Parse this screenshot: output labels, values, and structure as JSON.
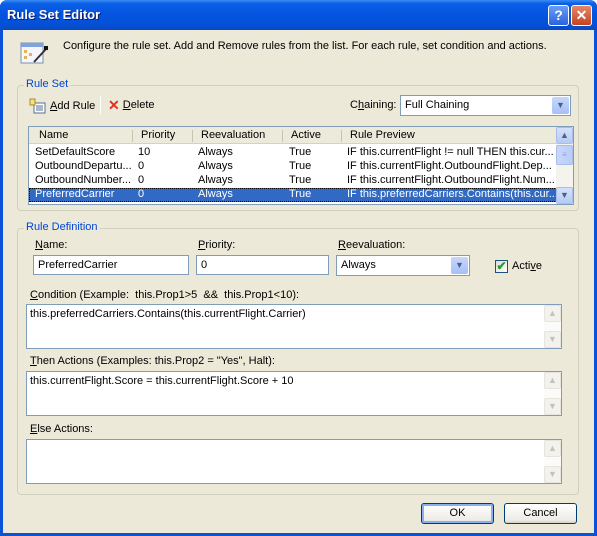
{
  "window": {
    "title": "Rule Set Editor",
    "help_glyph": "?",
    "close_glyph": "✕"
  },
  "header": {
    "icon": "rule-set-editor-icon",
    "description": "Configure the rule set. Add and Remove rules from the list. For each rule, set condition and actions."
  },
  "rule_set": {
    "group_label": "Rule Set",
    "toolbar": {
      "add_rule": {
        "icon": "add-rule-icon",
        "mnemonic": "A",
        "rest": "dd Rule"
      },
      "delete": {
        "icon": "delete-x-icon",
        "mnemonic": "D",
        "rest": "elete"
      }
    },
    "chaining": {
      "label_pre": "C",
      "label_mnemonic": "h",
      "label_post": "aining:",
      "value": "Full Chaining"
    },
    "columns": [
      "Name",
      "Priority",
      "Reevaluation",
      "Active",
      "Rule Preview"
    ],
    "rows": [
      {
        "name": "SetDefaultScore",
        "priority": "10",
        "reevaluation": "Always",
        "active": "True",
        "preview": "IF this.currentFlight != null THEN this.cur..."
      },
      {
        "name": "OutboundDepartu...",
        "priority": "0",
        "reevaluation": "Always",
        "active": "True",
        "preview": "IF this.currentFlight.OutboundFlight.Dep..."
      },
      {
        "name": "OutboundNumber...",
        "priority": "0",
        "reevaluation": "Always",
        "active": "True",
        "preview": "IF this.currentFlight.OutboundFlight.Num..."
      },
      {
        "name": "PreferredCarrier",
        "priority": "0",
        "reevaluation": "Always",
        "active": "True",
        "preview": "IF this.preferredCarriers.Contains(this.cur..."
      }
    ],
    "selected_row": 3
  },
  "rule_definition": {
    "group_label": "Rule Definition",
    "name": {
      "mnemonic": "N",
      "rest": "ame:",
      "value": "PreferredCarrier"
    },
    "priority": {
      "mnemonic": "P",
      "rest": "riority:",
      "value": "0"
    },
    "reevaluation": {
      "mnemonic": "R",
      "rest": "eevaluation:",
      "value": "Always"
    },
    "active": {
      "pre": "Acti",
      "mnemonic": "v",
      "post": "e",
      "checked": true
    },
    "condition": {
      "mnemonic": "C",
      "rest": "ondition (Example:  this.Prop1>5  &&  this.Prop1<10):",
      "value": "this.preferredCarriers.Contains(this.currentFlight.Carrier)"
    },
    "then_actions": {
      "mnemonic": "T",
      "rest": "hen Actions (Examples: this.Prop2 = \"Yes\", Halt):",
      "value": "this.currentFlight.Score = this.currentFlight.Score + 10"
    },
    "else_actions": {
      "mnemonic": "E",
      "rest": "lse Actions:",
      "value": ""
    }
  },
  "buttons": {
    "ok": "OK",
    "cancel": "Cancel"
  },
  "glyphs": {
    "chevron_down": "▼",
    "chevron_up": "▲",
    "checkmark": "✔",
    "grip": "≡"
  }
}
